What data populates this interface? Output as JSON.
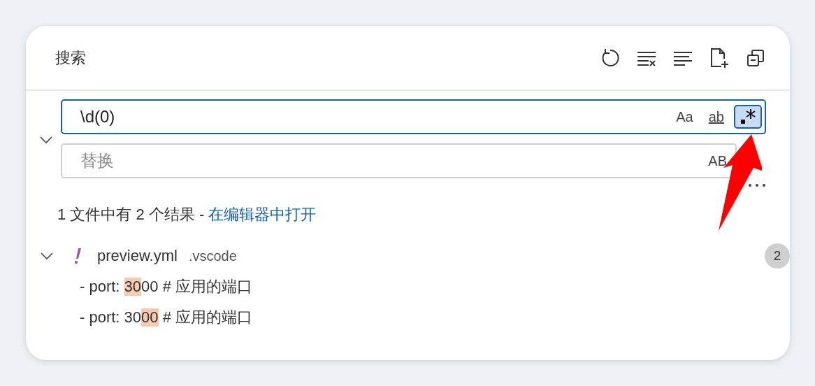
{
  "panel": {
    "title": "搜索"
  },
  "search": {
    "value": "\\d(0)",
    "toggles": [
      {
        "kind": "case",
        "label": "Aa",
        "selected": false
      },
      {
        "kind": "word",
        "label": "ab",
        "selected": false
      },
      {
        "kind": "regex",
        "selected": true
      }
    ]
  },
  "replace": {
    "placeholder": "替换",
    "toggle_label": "AB",
    "expanded": true
  },
  "summary": {
    "text": "1 文件中有 2 个结果 - ",
    "link": "在编辑器中打开"
  },
  "file": {
    "name": "preview.yml",
    "folder": ".vscode",
    "count": "2",
    "expanded": true,
    "matches": [
      {
        "before": "- port: ",
        "match": "30",
        "after": "00 # 应用的端口"
      },
      {
        "before": "- port: 30",
        "match": "00",
        "after": " # 应用的端口"
      }
    ]
  }
}
